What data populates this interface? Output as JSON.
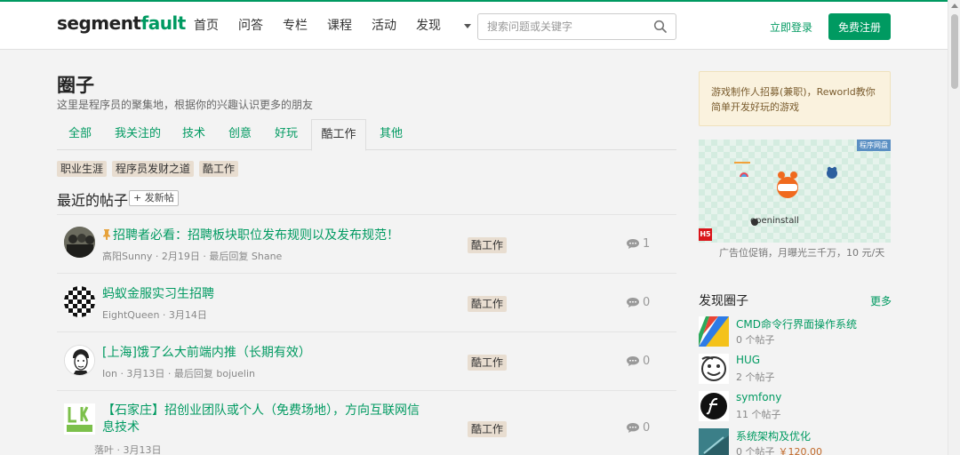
{
  "header": {
    "logo_main": "segment",
    "logo_accent": "fault",
    "nav": [
      "首页",
      "问答",
      "专栏",
      "课程",
      "活动",
      "发现"
    ],
    "search_placeholder": "搜索问题或关键字",
    "login": "立即登录",
    "register": "免费注册"
  },
  "page": {
    "title": "圈子",
    "subtitle": "这里是程序员的聚集地，根据你的兴趣认识更多的朋友",
    "tabs": [
      "全部",
      "我关注的",
      "技术",
      "创意",
      "好玩",
      "酷工作",
      "其他"
    ],
    "active_tab": "酷工作",
    "tags": [
      "职业生涯",
      "程序员发财之道",
      "酷工作"
    ],
    "section_title": "最近的帖子",
    "new_post_label": "+ 发新帖"
  },
  "posts": [
    {
      "title": "招聘者必看：招聘板块职位发布规则以及发布规范！",
      "pinned": true,
      "meta": "高阳Sunny · 2月19日 · 最后回复 Shane",
      "tag": "酷工作",
      "count": "1"
    },
    {
      "title": "蚂蚁金服实习生招聘",
      "pinned": false,
      "meta": "EightQueen · 3月14日",
      "tag": "酷工作",
      "count": "0"
    },
    {
      "title": "[上海]饿了么大前端内推（长期有效）",
      "pinned": false,
      "meta": "Ion · 3月13日 · 最后回复 bojuelin",
      "tag": "酷工作",
      "count": "0"
    },
    {
      "title": "【石家庄】招创业团队或个人（免费场地），方向互联网信息技术",
      "pinned": false,
      "meta": "落叶 · 3月13日",
      "tag": "酷工作",
      "count": "0"
    }
  ],
  "sidebar": {
    "ad_text": "游戏制作人招募(兼职)，Reworld教你简单开发好玩的游戏",
    "ad_badge": "程序网盘",
    "ad_brand": "openinstall",
    "ad_h5": "H5",
    "ad_caption": "广告位促销，月曝光三千万，10 元/天",
    "circles_title": "发现圈子",
    "more": "更多",
    "circles": [
      {
        "name": "CMD命令行界面操作系统",
        "count": "0 个帖子",
        "price": ""
      },
      {
        "name": "HUG",
        "count": "2 个帖子",
        "price": ""
      },
      {
        "name": "symfony",
        "count": "11 个帖子",
        "price": ""
      },
      {
        "name": "系统架构及优化",
        "count": "0 个帖子",
        "price": "￥120.00"
      }
    ]
  },
  "colors": {
    "brand": "#009a61",
    "tag_bg": "#e8ddd0",
    "ad_bg": "#faf2de"
  }
}
